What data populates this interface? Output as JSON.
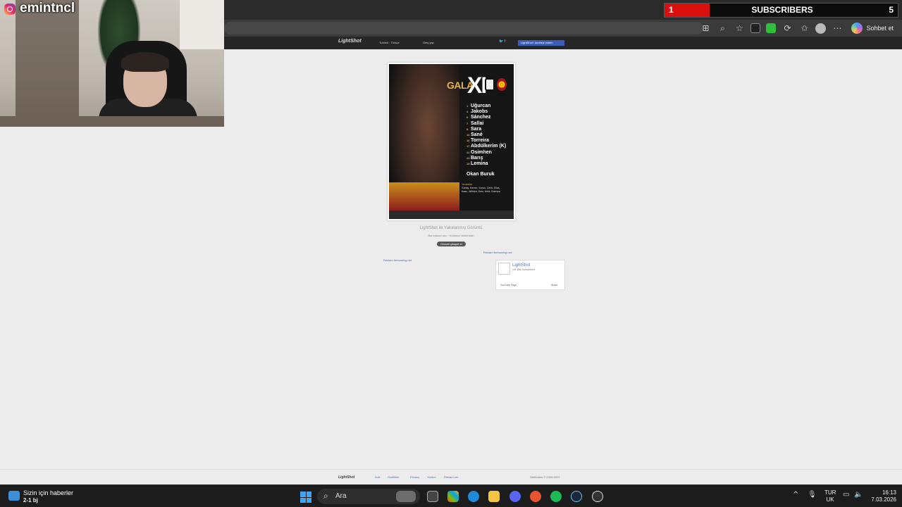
{
  "stream": {
    "channel_name": "emintncl",
    "subscribers_label": "SUBSCRIBERS",
    "subscribers_progress": "1",
    "subscribers_goal": "5"
  },
  "browser": {
    "toolbar_icons": [
      "split-screen-icon",
      "zoom-icon",
      "favorite-star-icon",
      "extension-icon",
      "extension-icon",
      "refresh-icon",
      "favorites-icon",
      "profile-icon",
      "more-icon"
    ],
    "copilot_label": "Sohbet et"
  },
  "lightshot": {
    "header": {
      "logo": "LightShot",
      "lang": "Turkish · Türkçe",
      "login": "Giriş yap",
      "download": "LightShot'ı ücretsiz indirin"
    },
    "poster": {
      "gala": "GALA",
      "xi": "XI",
      "players": [
        {
          "num": "1",
          "name": "Uğurcan"
        },
        {
          "num": "4",
          "name": "Jakobs"
        },
        {
          "num": "6",
          "name": "Sánchez"
        },
        {
          "num": "7",
          "name": "Sallai"
        },
        {
          "num": "8",
          "name": "Sara"
        },
        {
          "num": "10",
          "name": "Sané"
        },
        {
          "num": "16",
          "name": "Torreira"
        },
        {
          "num": "17",
          "name": "Abdülkerim (K)"
        },
        {
          "num": "21",
          "name": "Osimhen"
        },
        {
          "num": "23",
          "name": "Barış"
        },
        {
          "num": "18",
          "name": "Lemina"
        }
      ],
      "coach": "Okan Buruk",
      "subs_title": "Yedekler",
      "subs_list": "Günay, Kerem, Yunus, Cenk, Elias, Kaan, Wilfried, Eren, Arda, Ederson"
    },
    "caption": "LightShot ile Yakalanmış Görüntü",
    "meta": "Barınaktan alın · Kullanıcı tarafından",
    "report_label": "Görseli şikayet et",
    "ad_link_left": "Reklam freewaring.net",
    "ad_link_right": "Reklam freewaring.net",
    "youtube": {
      "name": "LightShot",
      "subscribers": "191,886 Subscribers",
      "page_btn": "YouTube Page",
      "share_btn": "Share"
    },
    "footer": {
      "logo": "LightShot",
      "links": [
        "İndir",
        "Özellikler",
        "Privacy",
        "Yardım",
        "Reklam ver"
      ],
      "copyright": "Skillbrains © 2009-2022"
    }
  },
  "taskbar": {
    "news_title": "Sizin için haberler",
    "news_score": "2-1 bj",
    "search_placeholder": "Ara",
    "lang_top": "TUR",
    "lang_bottom": "UK",
    "time": "16:13",
    "date": "7.03.2026"
  },
  "colors": {
    "subs_red": "#d90e0e",
    "page_bg": "#ececec",
    "accent_gold": "#e3b341",
    "link_blue": "#4a6fb5"
  }
}
